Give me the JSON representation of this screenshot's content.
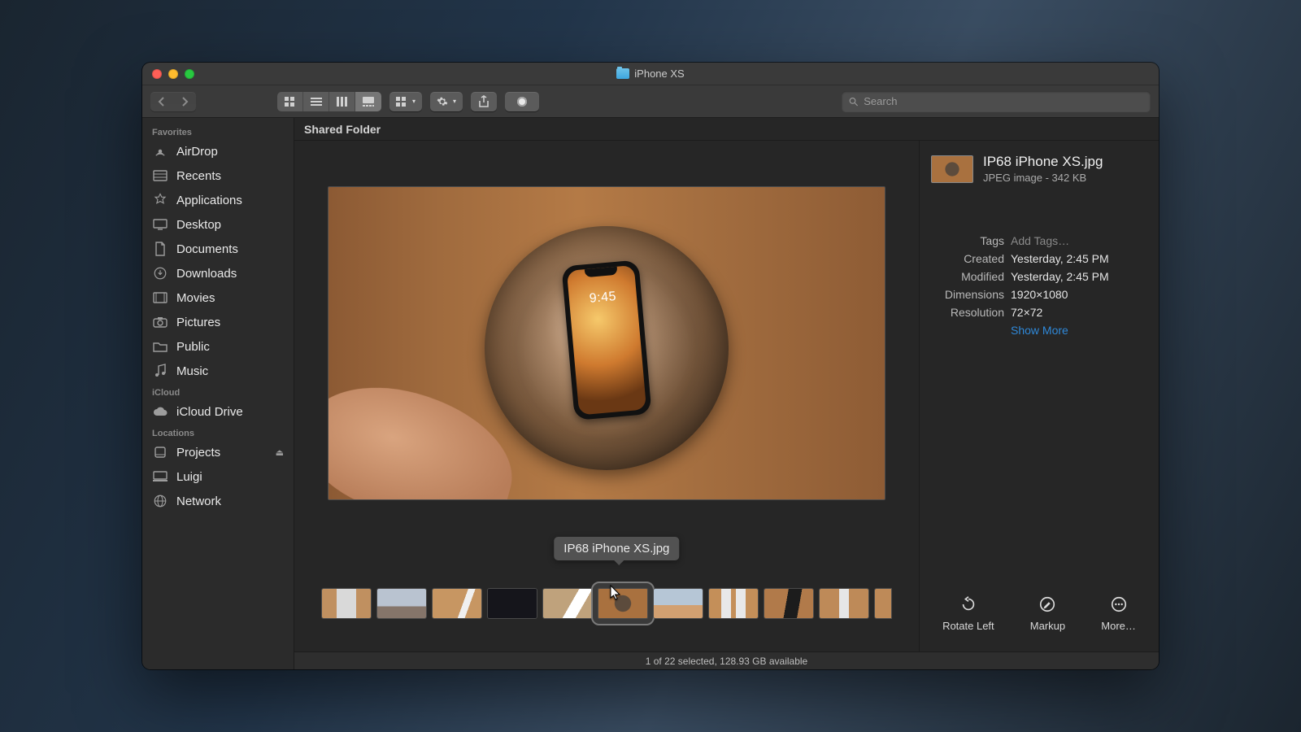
{
  "window": {
    "title": "iPhone XS"
  },
  "search": {
    "placeholder": "Search"
  },
  "pathbar": {
    "label": "Shared Folder"
  },
  "sidebar": {
    "sections": [
      {
        "heading": "Favorites",
        "items": [
          "AirDrop",
          "Recents",
          "Applications",
          "Desktop",
          "Documents",
          "Downloads",
          "Movies",
          "Pictures",
          "Public",
          "Music"
        ]
      },
      {
        "heading": "iCloud",
        "items": [
          "iCloud Drive"
        ]
      },
      {
        "heading": "Locations",
        "items": [
          "Projects",
          "Luigi",
          "Network"
        ]
      }
    ]
  },
  "preview": {
    "tooltip_filename": "IP68 iPhone XS.jpg",
    "phone_time": "9:45"
  },
  "info": {
    "filename": "IP68 iPhone XS.jpg",
    "kind_size": "JPEG image - 342 KB",
    "tags_label": "Tags",
    "tags_placeholder": "Add Tags…",
    "created_label": "Created",
    "created_value": "Yesterday, 2:45 PM",
    "modified_label": "Modified",
    "modified_value": "Yesterday, 2:45 PM",
    "dimensions_label": "Dimensions",
    "dimensions_value": "1920×1080",
    "resolution_label": "Resolution",
    "resolution_value": "72×72",
    "show_more": "Show More"
  },
  "quick_actions": {
    "rotate_left": "Rotate Left",
    "markup": "Markup",
    "more": "More…"
  },
  "status": {
    "text": "1 of 22 selected, 128.93 GB available"
  }
}
